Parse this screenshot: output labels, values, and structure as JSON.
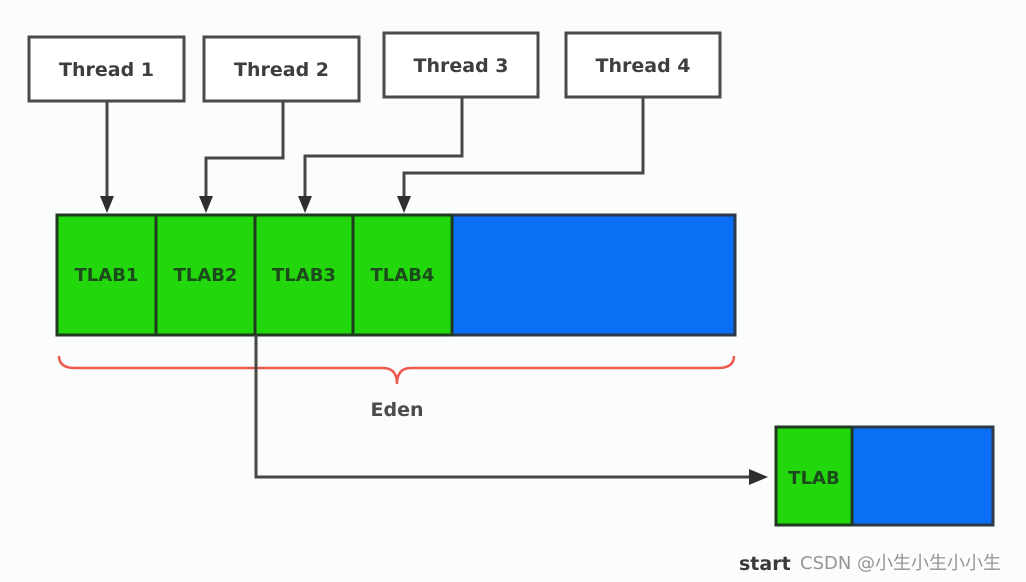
{
  "diagram": {
    "threads": [
      {
        "label": "Thread 1",
        "target": "TLAB1"
      },
      {
        "label": "Thread 2",
        "target": "TLAB2"
      },
      {
        "label": "Thread 3",
        "target": "TLAB3"
      },
      {
        "label": "Thread 4",
        "target": "TLAB4"
      }
    ],
    "eden": {
      "label": "Eden",
      "tlabs": [
        "TLAB1",
        "TLAB2",
        "TLAB3",
        "TLAB4"
      ],
      "tlab_color": "#22d80d",
      "free_color": "#0a6ff5"
    },
    "detail": {
      "tlab_label": "TLAB",
      "tlab_color": "#22d80d",
      "free_color": "#0a6ff5"
    },
    "brace_color": "#ef5a50",
    "footer_label": "start",
    "watermark": "CSDN @小生小生小小生"
  }
}
